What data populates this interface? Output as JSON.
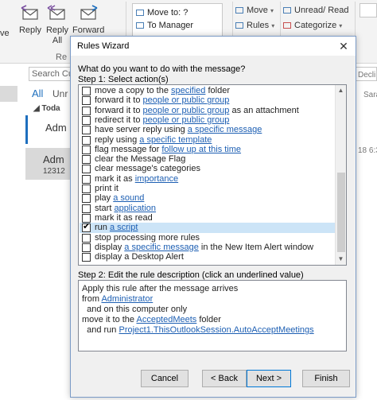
{
  "ribbon": {
    "reply_all_prefix": "ve",
    "reply": "Reply",
    "reply_all": [
      "Reply",
      "All"
    ],
    "forward": "Forward",
    "respond_group": "Re",
    "quick_steps": [
      "Move to: ?",
      "To Manager"
    ],
    "move": "Move",
    "rules": "Rules",
    "unread_read": "Unread/ Read",
    "categorize": "Categorize"
  },
  "mail_list": {
    "search_placeholder": "Search Cu",
    "filter_all": "All",
    "filter_unread": "Unr",
    "group_today": "Toda",
    "item1_sender": "Adm",
    "item2_sender": "Adm",
    "item2_sub": "12312"
  },
  "reading_pane": {
    "decline": "Decli",
    "sara": "Sara",
    "time": "18 6:3"
  },
  "dialog": {
    "title": "Rules Wizard",
    "question": "What do you want to do with the message?",
    "step1": "Step 1: Select action(s)",
    "actions": [
      {
        "pre": "move a copy to the ",
        "link": "specified",
        "post": " folder",
        "checked": false
      },
      {
        "pre": "forward it to ",
        "link": "people or public group",
        "post": "",
        "checked": false
      },
      {
        "pre": "forward it to ",
        "link": "people or public group",
        "post": " as an attachment",
        "checked": false
      },
      {
        "pre": "redirect it to ",
        "link": "people or public group",
        "post": "",
        "checked": false
      },
      {
        "pre": "have server reply using ",
        "link": "a specific message",
        "post": "",
        "checked": false
      },
      {
        "pre": "reply using ",
        "link": "a specific template",
        "post": "",
        "checked": false
      },
      {
        "pre": "flag message for ",
        "link": "follow up at this time",
        "post": "",
        "checked": false
      },
      {
        "pre": "clear the Message Flag",
        "link": "",
        "post": "",
        "checked": false
      },
      {
        "pre": "clear message's categories",
        "link": "",
        "post": "",
        "checked": false
      },
      {
        "pre": "mark it as ",
        "link": "importance",
        "post": "",
        "checked": false
      },
      {
        "pre": "print it",
        "link": "",
        "post": "",
        "checked": false
      },
      {
        "pre": "play ",
        "link": "a sound",
        "post": "",
        "checked": false
      },
      {
        "pre": "start ",
        "link": "application",
        "post": "",
        "checked": false
      },
      {
        "pre": "mark it as read",
        "link": "",
        "post": "",
        "checked": false
      },
      {
        "pre": "run ",
        "link": "a script",
        "post": "",
        "checked": true
      },
      {
        "pre": "stop processing more rules",
        "link": "",
        "post": "",
        "checked": false
      },
      {
        "pre": "display ",
        "link": "a specific message",
        "post": " in the New Item Alert window",
        "checked": false
      },
      {
        "pre": "display a Desktop Alert",
        "link": "",
        "post": "",
        "checked": false
      }
    ],
    "step2": "Step 2: Edit the rule description (click an underlined value)",
    "description": {
      "line1": "Apply this rule after the message arrives",
      "from_pre": "from ",
      "from_link": "Administrator",
      "line3": "  and on this computer only",
      "move_pre": "move it to the ",
      "move_link": "AcceptedMeets",
      "move_post": " folder",
      "run_pre": "  and run ",
      "run_link": "Project1.ThisOutlookSession.AutoAcceptMeetings"
    },
    "buttons": {
      "cancel": "Cancel",
      "back": "< Back",
      "next": "Next >",
      "finish": "Finish"
    },
    "close_glyph": "✕"
  },
  "colors": {
    "link": "#1d5fb3",
    "selection": "#cce4f7",
    "accent": "#1e6fbe",
    "default_button_border": "#0078d7"
  }
}
